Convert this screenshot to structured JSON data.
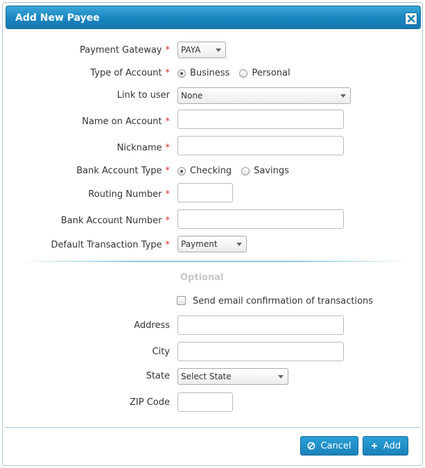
{
  "dialog": {
    "title": "Add New Payee",
    "accent": "#1a86c0"
  },
  "form": {
    "payment_gateway": {
      "label": "Payment Gateway",
      "required": "*",
      "value": "PAYA"
    },
    "type_of_account": {
      "label": "Type of Account",
      "required": "*",
      "options": [
        "Business",
        "Personal"
      ],
      "selected": "Business"
    },
    "link_to_user": {
      "label": "Link to user",
      "value": "None"
    },
    "name_on_account": {
      "label": "Name on Account",
      "required": "*",
      "value": ""
    },
    "nickname": {
      "label": "Nickname",
      "required": "*",
      "value": ""
    },
    "bank_account_type": {
      "label": "Bank Account Type",
      "required": "*",
      "options": [
        "Checking",
        "Savings"
      ],
      "selected": "Checking"
    },
    "routing_number": {
      "label": "Routing Number",
      "required": "*",
      "value": ""
    },
    "bank_account_number": {
      "label": "Bank Account Number",
      "required": "*",
      "value": ""
    },
    "default_transaction_type": {
      "label": "Default Transaction Type",
      "required": "*",
      "value": "Payment"
    }
  },
  "optional": {
    "title": "Optional",
    "email_confirmation": {
      "label": "Send email confirmation of transactions",
      "checked": false
    },
    "address": {
      "label": "Address",
      "value": ""
    },
    "city": {
      "label": "City",
      "value": ""
    },
    "state": {
      "label": "State",
      "value": "Select State"
    },
    "zip": {
      "label": "ZIP Code",
      "value": ""
    }
  },
  "footer": {
    "cancel_label": "Cancel",
    "add_label": "Add"
  }
}
